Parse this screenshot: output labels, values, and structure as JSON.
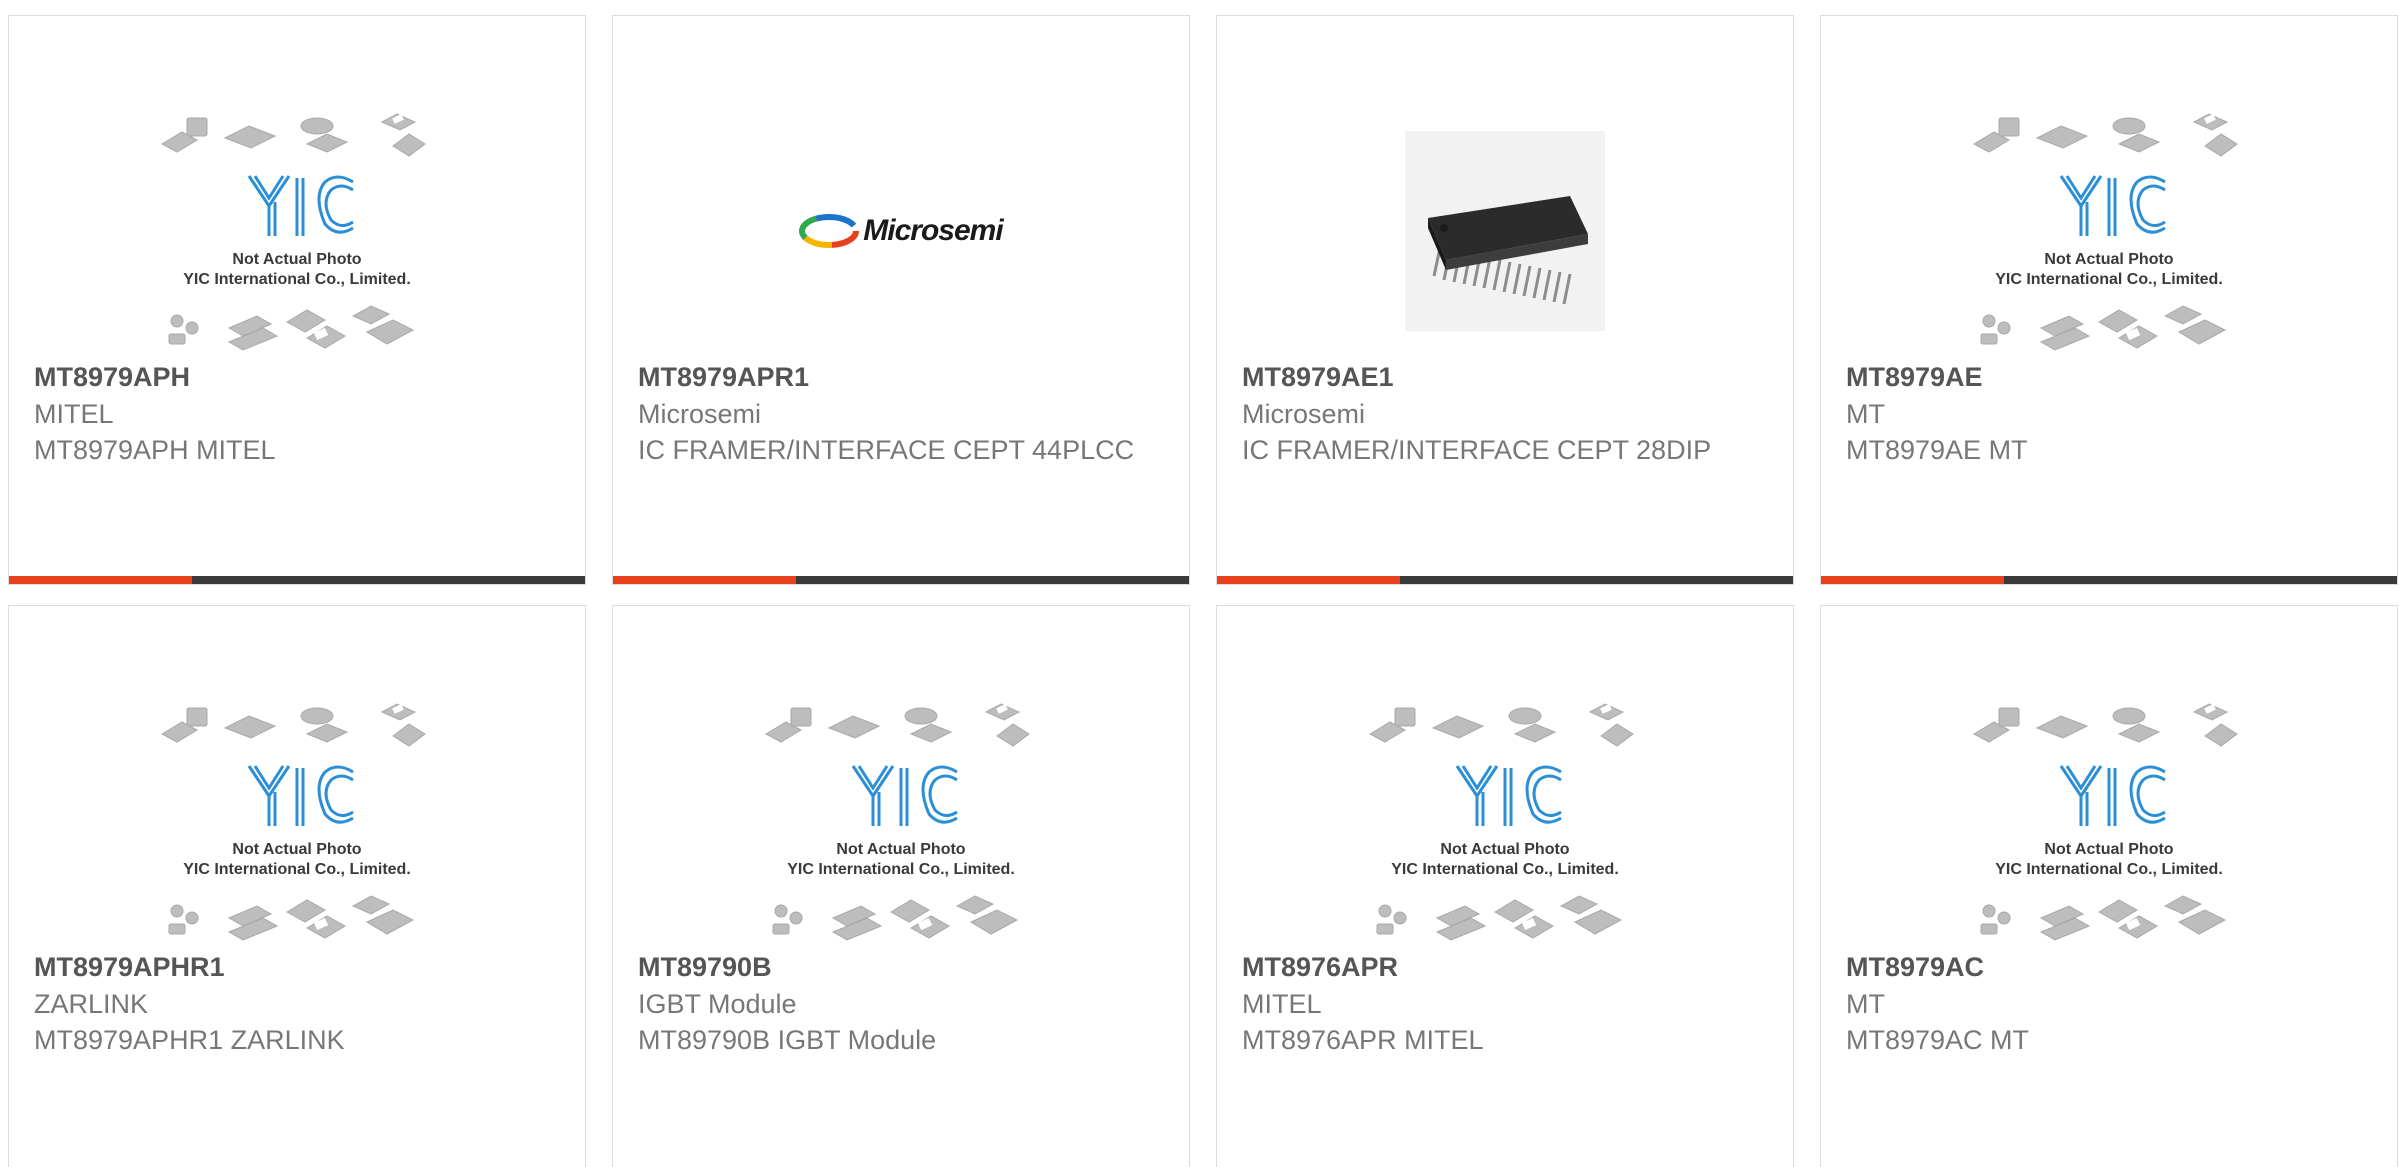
{
  "placeholder": {
    "caption_line1": "Not Actual Photo",
    "caption_line2": "YIC International Co., Limited.",
    "logo_letters": "YIC"
  },
  "colors": {
    "accent": "#e8401c",
    "bar": "#3a3a3a",
    "yic_blue": "#2a8fd6"
  },
  "products": [
    {
      "part": "MT8979APH",
      "brand": "MITEL",
      "desc": "MT8979APH MITEL",
      "image": "placeholder"
    },
    {
      "part": "MT8979APR1",
      "brand": "Microsemi",
      "desc": "IC FRAMER/INTERFACE CEPT 44PLCC",
      "image": "microsemi-logo"
    },
    {
      "part": "MT8979AE1",
      "brand": "Microsemi",
      "desc": "IC FRAMER/INTERFACE CEPT 28DIP",
      "image": "dip-chip-photo"
    },
    {
      "part": "MT8979AE",
      "brand": "MT",
      "desc": "MT8979AE MT",
      "image": "placeholder"
    },
    {
      "part": "MT8979APHR1",
      "brand": "ZARLINK",
      "desc": "MT8979APHR1 ZARLINK",
      "image": "placeholder"
    },
    {
      "part": "MT89790B",
      "brand": "IGBT Module",
      "desc": "MT89790B IGBT Module",
      "image": "placeholder"
    },
    {
      "part": "MT8976APR",
      "brand": "MITEL",
      "desc": "MT8976APR MITEL",
      "image": "placeholder"
    },
    {
      "part": "MT8979AC",
      "brand": "MT",
      "desc": "MT8979AC MT",
      "image": "placeholder"
    }
  ],
  "microsemi": {
    "logo_text": "Microsemi"
  }
}
